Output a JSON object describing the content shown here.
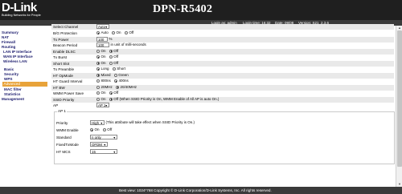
{
  "header": {
    "logo_text": "D-Link",
    "logo_tagline": "Building Networks for People",
    "model": "DPN-R5402"
  },
  "status": {
    "login": "Login as: admin",
    "login_time": "Login time: 16:32",
    "date": "Date: 09/08",
    "version": "Version: S21_2.3.6"
  },
  "sidebar": {
    "items": [
      {
        "label": "Summary",
        "level": "top"
      },
      {
        "label": "NAT",
        "level": "top"
      },
      {
        "label": "Firewall",
        "level": "top"
      },
      {
        "label": "Routing",
        "level": "top"
      },
      {
        "label": "LAN IP Interface",
        "level": "sub"
      },
      {
        "label": "WAN IP Interface",
        "level": "sub"
      },
      {
        "label": "Wireless LAN",
        "level": "sub"
      },
      {
        "label": "Basic",
        "level": "subsub"
      },
      {
        "label": "Security",
        "level": "subsub"
      },
      {
        "label": "WPS",
        "level": "subsub"
      },
      {
        "label": "Advanced",
        "level": "active"
      },
      {
        "label": "MAC filter",
        "level": "subsub"
      },
      {
        "label": "Statistics",
        "level": "subsub"
      },
      {
        "label": "Management",
        "level": "top"
      }
    ]
  },
  "form": {
    "select_channel": {
      "label": "Select Channel",
      "value": "Auto"
    },
    "b_g_protection": {
      "label": "B/G Protection",
      "options": [
        "Auto",
        "On",
        "Off"
      ],
      "selected": "Auto"
    },
    "tx_power": {
      "label": "Tx Power",
      "value": "100",
      "unit": "%"
    },
    "beacon_period": {
      "label": "Beacon Period",
      "value": "100",
      "unit": "in unit of milli-seconds"
    },
    "enable_dlsc": {
      "label": "Enable DLSC",
      "options": [
        "On",
        "Off"
      ],
      "selected": "Off"
    },
    "tx_burst": {
      "label": "Tx Burst",
      "options": [
        "On",
        "Off"
      ],
      "selected": "On"
    },
    "short_slot": {
      "label": "Short Slot",
      "options": [
        "On",
        "Off"
      ],
      "selected": "On"
    },
    "tx_preamble": {
      "label": "Tx Preamble",
      "options": [
        "Long",
        "Short"
      ],
      "selected": "Long"
    },
    "ht_opmode": {
      "label": "HT OpMode",
      "options": [
        "Mixed",
        "Green"
      ],
      "selected": "Mixed"
    },
    "ht_guard_interval": {
      "label": "HT Guard Interval",
      "options": [
        "800ns",
        "400ns"
      ],
      "selected": "400ns"
    },
    "ht_bw": {
      "label": "HT BW",
      "options": [
        "20MHz",
        "20/40MHz"
      ],
      "selected": "20/40MHz"
    },
    "wmm_power_save": {
      "label": "WMM Power Save",
      "options": [
        "On",
        "Off"
      ],
      "selected": "Off"
    },
    "ssid_priority": {
      "label": "SSID Priority",
      "options": [
        "On",
        "Off (When SSID Priority is On, WMM Enable of All AP is auto On.)"
      ],
      "selected": "Off"
    },
    "ap": {
      "label": "AP",
      "value": "AP 1"
    }
  },
  "ap_section": {
    "legend": "AP 1",
    "priority": {
      "label": "Priority",
      "value": "High",
      "note": "(This attribute will take effect when SSID Priority is On.)"
    },
    "wmm_enable": {
      "label": "WMM Enable",
      "options": [
        "On",
        "Off"
      ],
      "selected": "On"
    },
    "standard": {
      "label": "Standard",
      "value": "n only"
    },
    "fixed_tx_mode": {
      "label": "FixedTxMode",
      "value": "OFDM"
    },
    "ht_mcs": {
      "label": "HT MCS",
      "value": "15"
    }
  },
  "footer": {
    "text": "Best view: 1024*768 Copyright © D-Link Corporation/D-Link Systems, Inc. All rights reserved."
  }
}
